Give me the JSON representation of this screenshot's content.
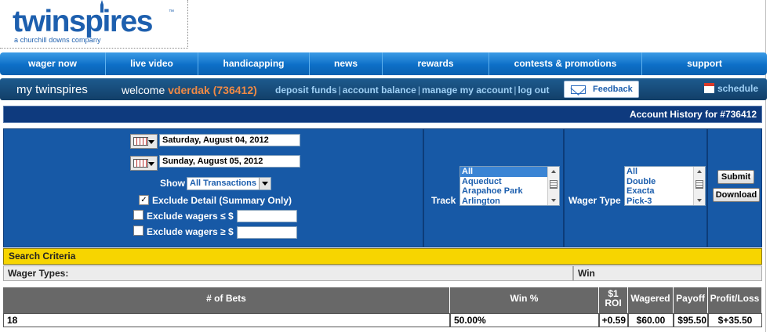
{
  "logo": {
    "word": "twinspires",
    "trademark": "™",
    "tagline": "a churchill downs company"
  },
  "mainnav": [
    "wager now",
    "live video",
    "handicapping",
    "news",
    "rewards",
    "contests & promotions",
    "support"
  ],
  "acctbar": {
    "title": "my twinspires",
    "welcome_prefix": "welcome",
    "username": "vderdak (736412)",
    "links": [
      "deposit funds",
      "account balance",
      "manage my account",
      "log out"
    ],
    "separator": "|",
    "feedback": "Feedback",
    "schedule": "schedule"
  },
  "history_title": "Account History for #736412",
  "filters": {
    "start_date": "Saturday, August 04, 2012",
    "end_date": "Sunday, August 05, 2012",
    "show_label": "Show",
    "show_value": "All Transactions",
    "exclude_detail_label": "Exclude Detail (Summary Only)",
    "exclude_detail_checked": true,
    "exclude_le_label": "Exclude wagers ≤ $",
    "exclude_ge_label": "Exclude wagers ≥ $",
    "track_label": "Track",
    "track_options": [
      "All",
      "Aqueduct",
      "Arapahoe Park",
      "Arlington"
    ],
    "wager_type_label": "Wager Type",
    "wager_type_options": [
      "All",
      "Double",
      "Exacta",
      "Pick-3"
    ],
    "submit": "Submit",
    "download": "Download"
  },
  "criteria": {
    "heading": "Search Criteria",
    "wager_types_label": "Wager Types:",
    "wager_types_value": "Win"
  },
  "results": {
    "columns": [
      "# of Bets",
      "Win %",
      "$1 ROI",
      "Wagered",
      "Payoff",
      "Profit/Loss"
    ],
    "roi_line1": "$1",
    "roi_line2": "ROI",
    "row": [
      "18",
      "50.00%",
      "+0.59",
      "$60.00",
      "$95.50",
      "$+35.50"
    ]
  },
  "colors": {
    "nav_blue": "#0d6fc7",
    "account_bar": "#1d5a8e",
    "panel_blue": "#1759a6",
    "criteria_yellow": "#f7d500",
    "username_orange": "#f08a45"
  }
}
